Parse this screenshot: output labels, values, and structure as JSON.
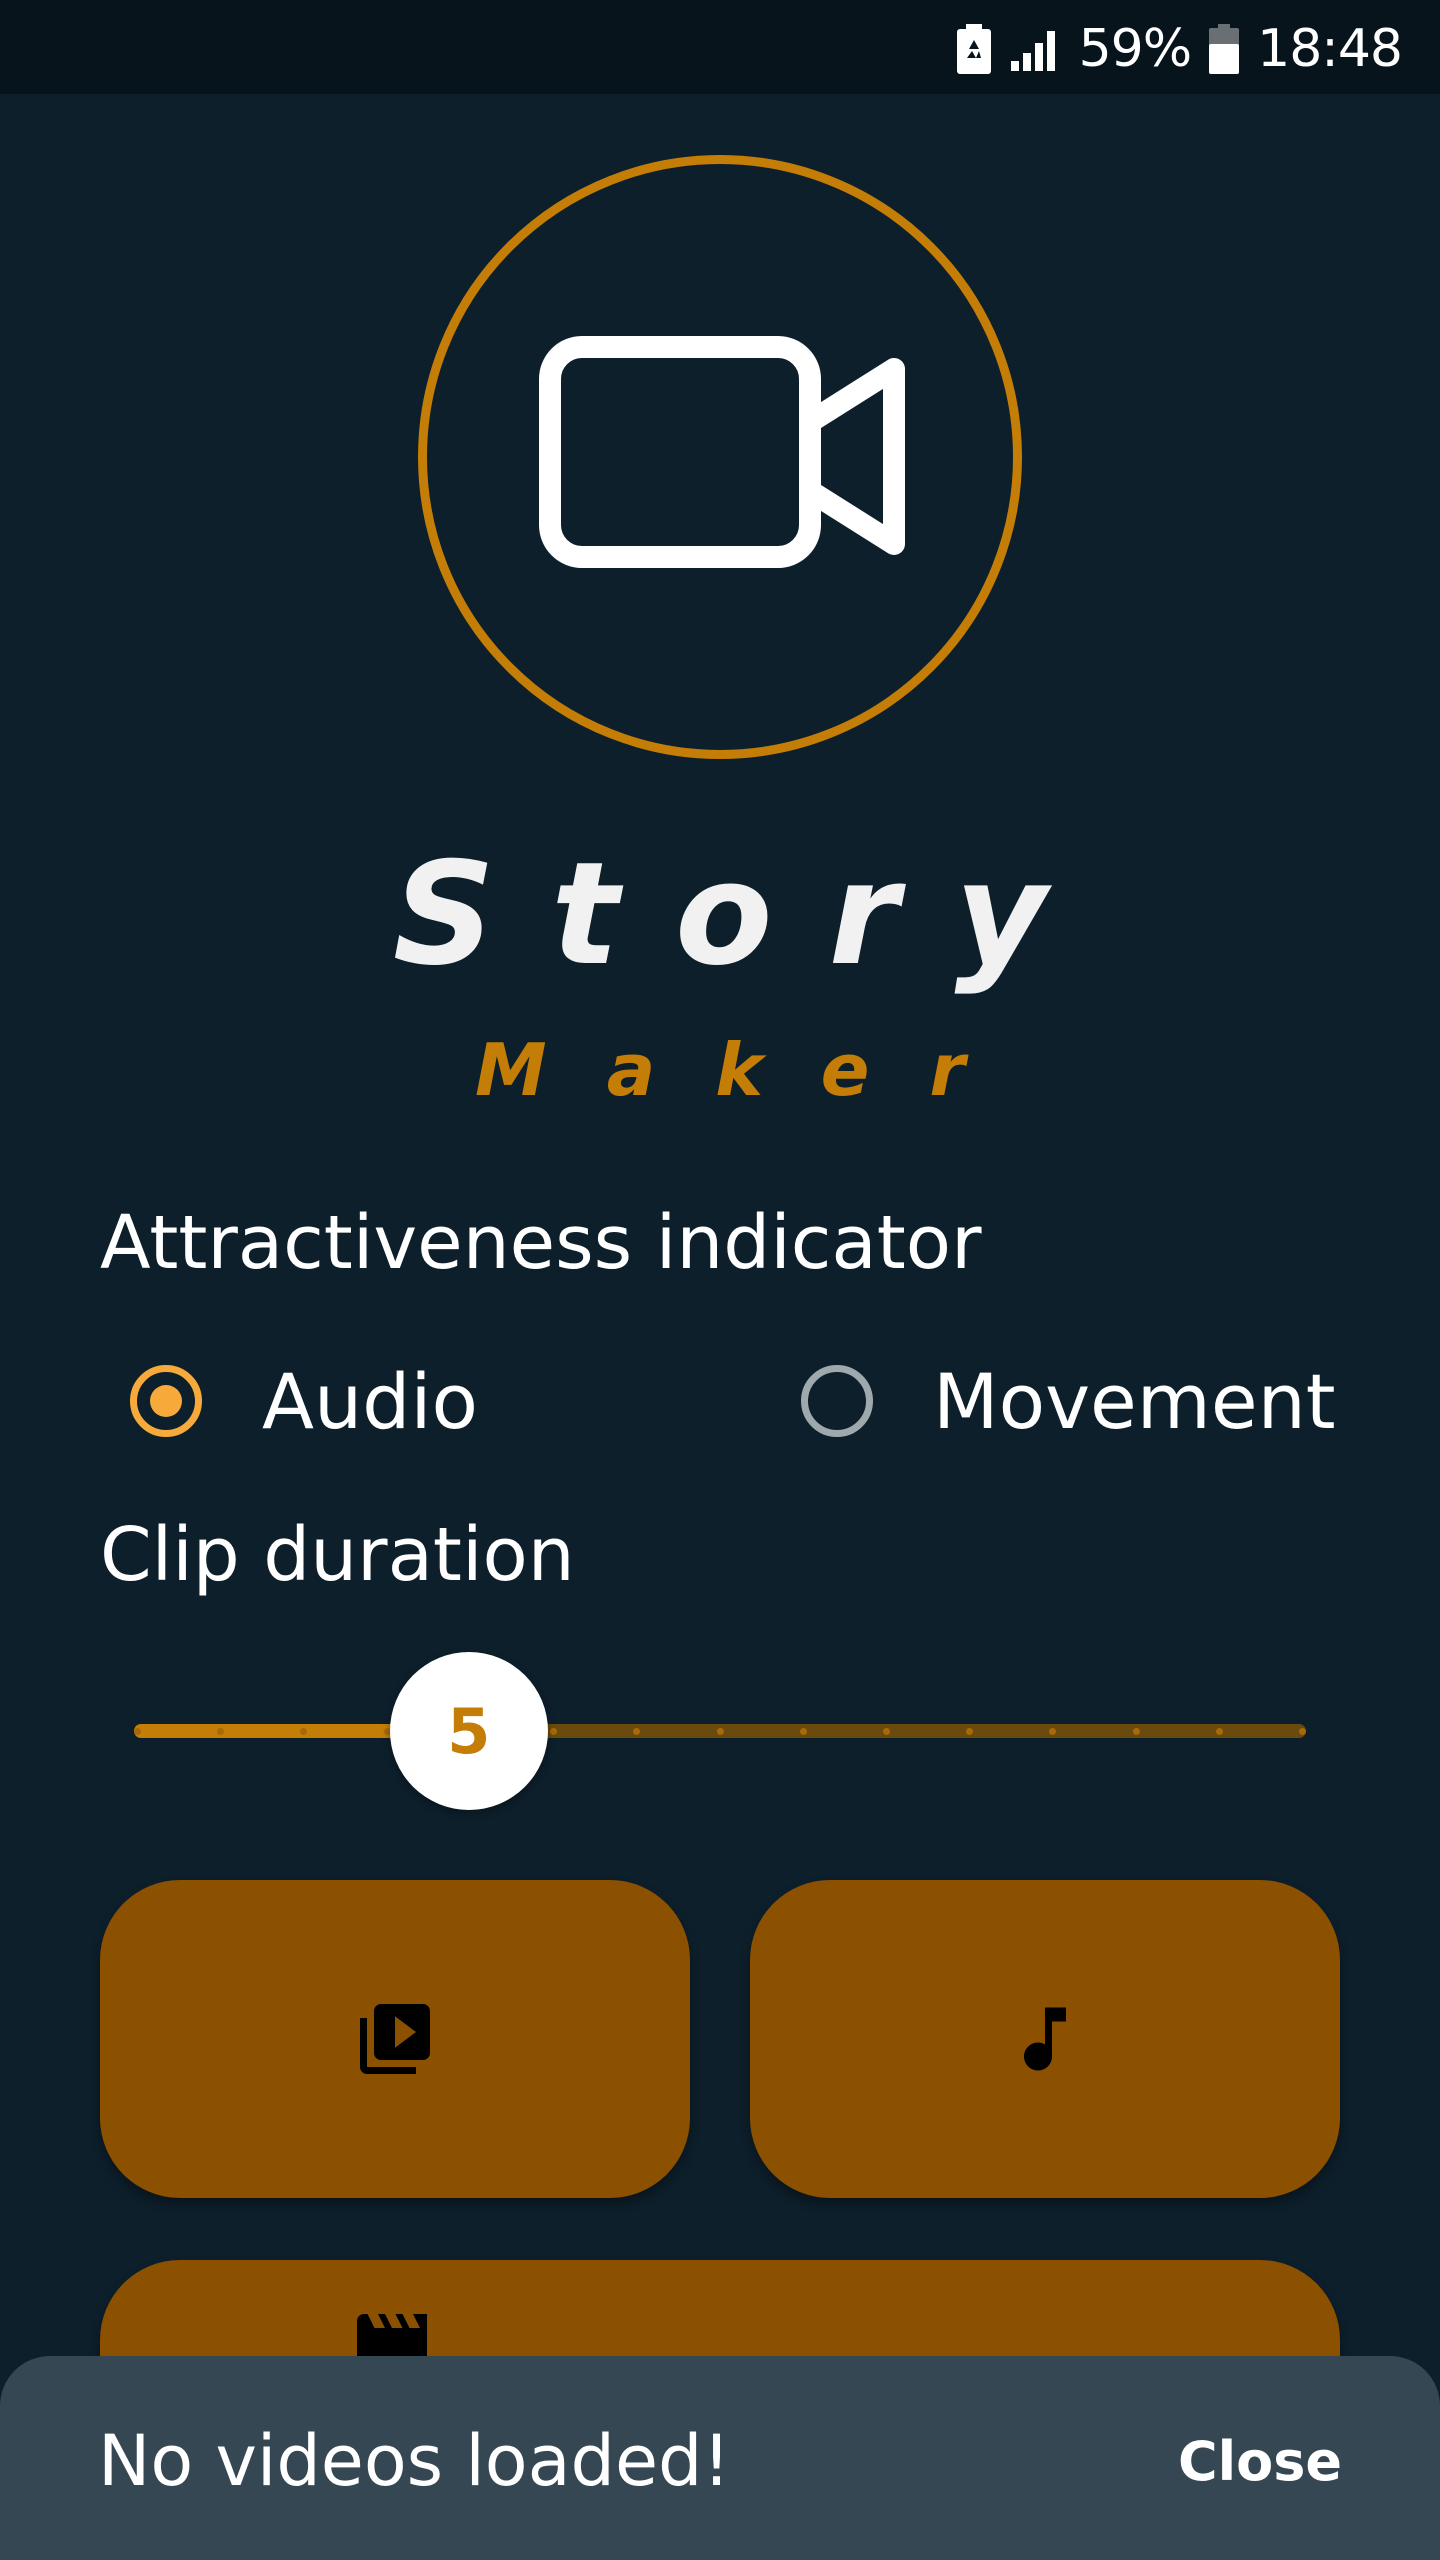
{
  "status_bar": {
    "battery_percent": "59%",
    "time": "18:48",
    "icons": [
      "battery-saver-icon",
      "signal-icon",
      "battery-icon"
    ]
  },
  "app": {
    "logo_icon": "video-camera-icon",
    "title_main": "Story",
    "title_sub": "Maker"
  },
  "attractiveness": {
    "label": "Attractiveness indicator",
    "options": [
      {
        "label": "Audio",
        "selected": true
      },
      {
        "label": "Movement",
        "selected": false
      }
    ]
  },
  "clip_duration": {
    "label": "Clip duration",
    "value": 5,
    "value_text": "5",
    "min": 1,
    "max": 15
  },
  "buttons": {
    "videos_icon": "video-library-icon",
    "music_icon": "music-note-icon",
    "create_icon": "movie-icon"
  },
  "snackbar": {
    "message": "No videos loaded!",
    "action": "Close"
  },
  "colors": {
    "accent": "#c47d06",
    "radio_active": "#f7a93a",
    "button_bg": "#8b5000",
    "background": "#0d1f2b"
  }
}
